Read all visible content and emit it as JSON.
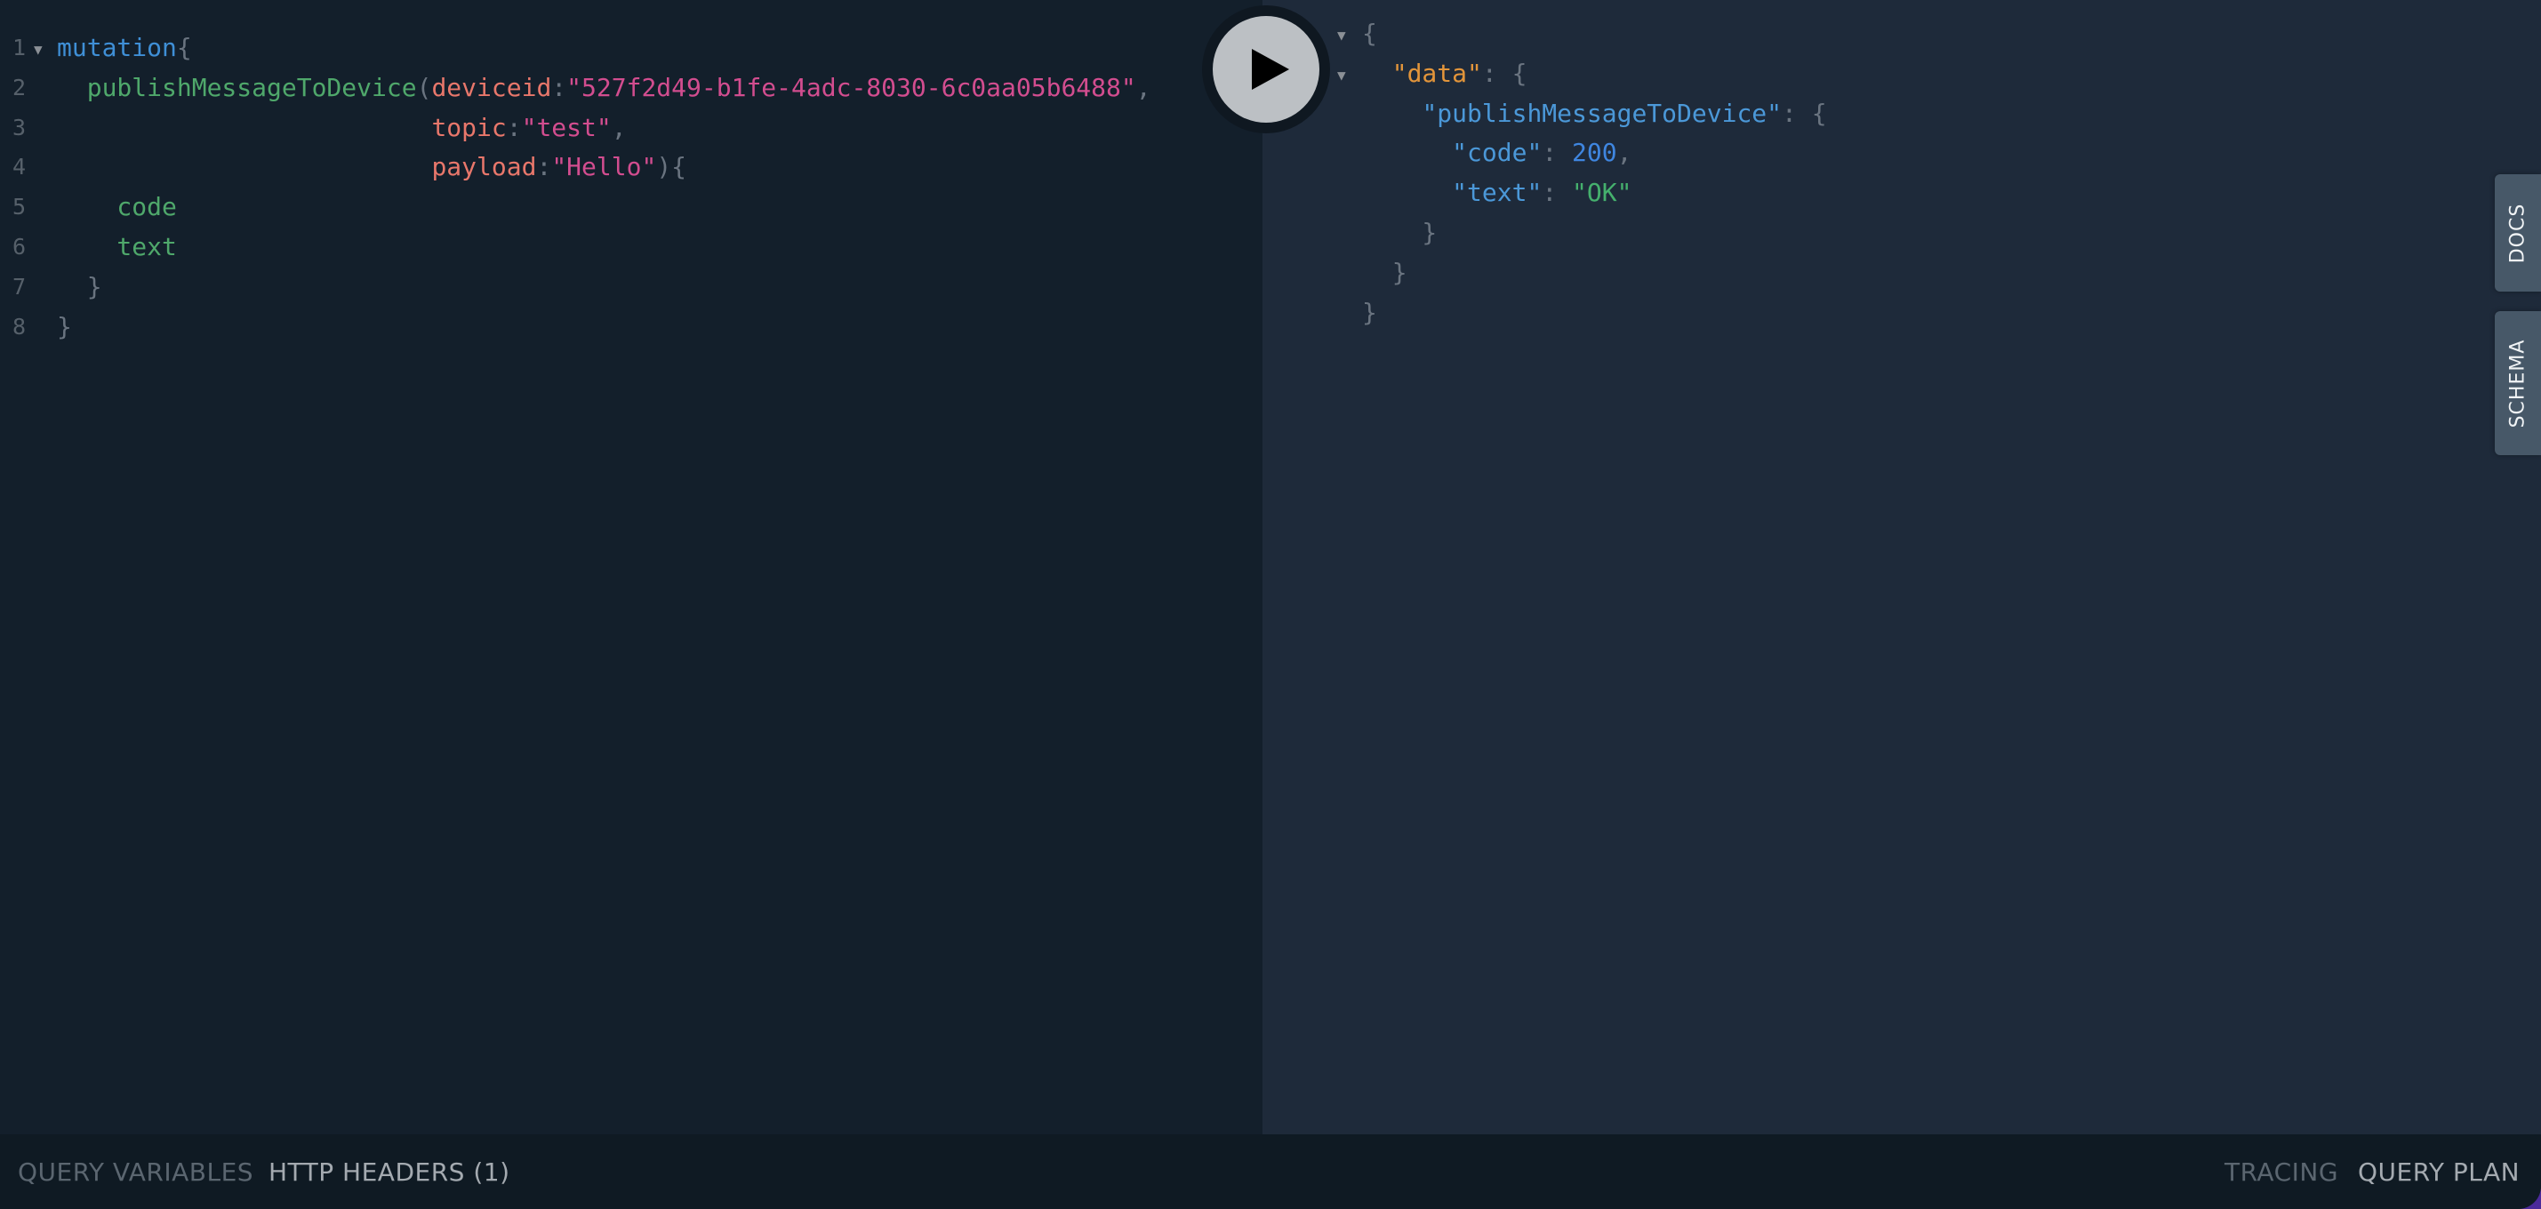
{
  "editor": {
    "lines": [
      {
        "n": "1",
        "tokens": [
          {
            "t": "mutation",
            "c": "kw"
          },
          {
            "t": "{",
            "c": "punc"
          }
        ]
      },
      {
        "n": "2",
        "tokens": [
          {
            "t": "  publishMessageToDevice",
            "c": "fn"
          },
          {
            "t": "(",
            "c": "punc"
          },
          {
            "t": "deviceid",
            "c": "arg"
          },
          {
            "t": ":",
            "c": "punc"
          },
          {
            "t": "\"527f2d49-b1fe-4adc-8030-6c0aa05b6488\"",
            "c": "str"
          },
          {
            "t": ",",
            "c": "punc"
          }
        ]
      },
      {
        "n": "3",
        "tokens": [
          {
            "t": "                         ",
            "c": "punc"
          },
          {
            "t": "topic",
            "c": "arg"
          },
          {
            "t": ":",
            "c": "punc"
          },
          {
            "t": "\"test\"",
            "c": "str"
          },
          {
            "t": ",",
            "c": "punc"
          }
        ]
      },
      {
        "n": "4",
        "tokens": [
          {
            "t": "                         ",
            "c": "punc"
          },
          {
            "t": "payload",
            "c": "arg"
          },
          {
            "t": ":",
            "c": "punc"
          },
          {
            "t": "\"Hello\"",
            "c": "str"
          },
          {
            "t": "){",
            "c": "punc"
          }
        ]
      },
      {
        "n": "5",
        "tokens": [
          {
            "t": "    code",
            "c": "fn"
          }
        ]
      },
      {
        "n": "6",
        "tokens": [
          {
            "t": "    text",
            "c": "fn"
          }
        ]
      },
      {
        "n": "7",
        "tokens": [
          {
            "t": "  }",
            "c": "punc"
          }
        ]
      },
      {
        "n": "8",
        "tokens": [
          {
            "t": "}",
            "c": "punc"
          }
        ]
      }
    ]
  },
  "result": {
    "lines": [
      {
        "fold": true,
        "tokens": [
          {
            "t": "{",
            "c": "punc"
          }
        ]
      },
      {
        "fold": true,
        "tokens": [
          {
            "t": "  ",
            "c": "punc"
          },
          {
            "t": "\"data\"",
            "c": "jkey-orange"
          },
          {
            "t": ": {",
            "c": "punc"
          }
        ]
      },
      {
        "fold": false,
        "tokens": [
          {
            "t": "    ",
            "c": "punc"
          },
          {
            "t": "\"publishMessageToDevice\"",
            "c": "jkey"
          },
          {
            "t": ": {",
            "c": "punc"
          }
        ]
      },
      {
        "fold": false,
        "tokens": [
          {
            "t": "      ",
            "c": "punc"
          },
          {
            "t": "\"code\"",
            "c": "jkey"
          },
          {
            "t": ": ",
            "c": "punc"
          },
          {
            "t": "200",
            "c": "jnum"
          },
          {
            "t": ",",
            "c": "punc"
          }
        ]
      },
      {
        "fold": false,
        "tokens": [
          {
            "t": "      ",
            "c": "punc"
          },
          {
            "t": "\"text\"",
            "c": "jkey"
          },
          {
            "t": ": ",
            "c": "punc"
          },
          {
            "t": "\"OK\"",
            "c": "jstr"
          }
        ]
      },
      {
        "fold": false,
        "tokens": [
          {
            "t": "    }",
            "c": "punc"
          }
        ]
      },
      {
        "fold": false,
        "tokens": [
          {
            "t": "  }",
            "c": "punc"
          }
        ]
      },
      {
        "fold": false,
        "tokens": [
          {
            "t": "}",
            "c": "punc"
          }
        ]
      }
    ]
  },
  "run_button": {
    "icon": "play-icon"
  },
  "side_tabs": {
    "docs": "DOCS",
    "schema": "SCHEMA"
  },
  "bottom_bar": {
    "query_variables": "QUERY VARIABLES",
    "http_headers": "HTTP HEADERS (1)",
    "tracing": "TRACING",
    "query_plan": "QUERY PLAN"
  }
}
